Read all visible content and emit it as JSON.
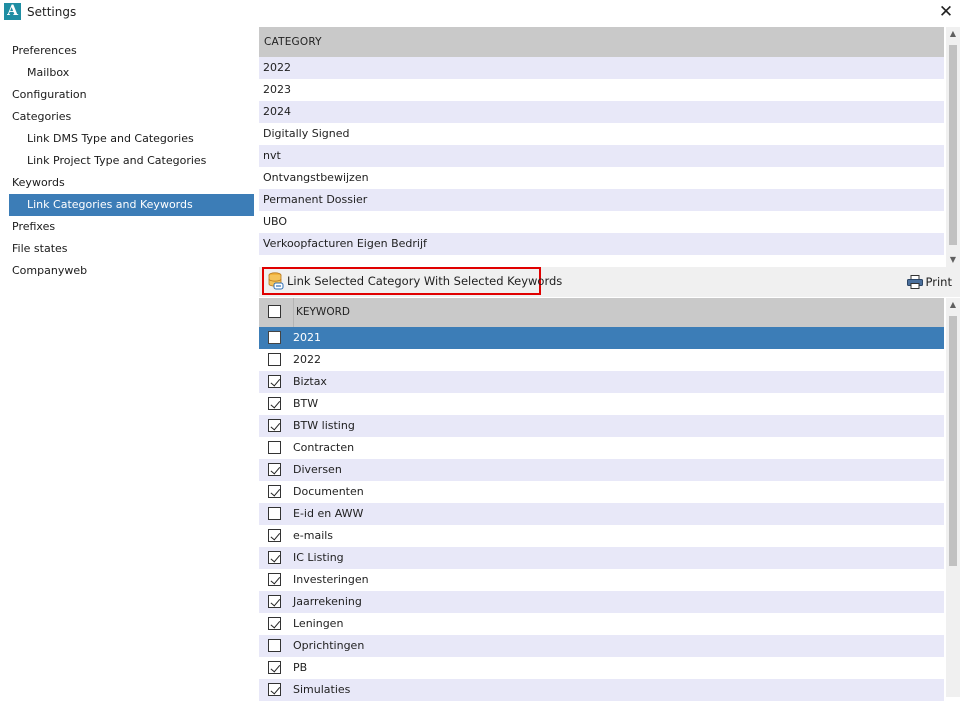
{
  "window": {
    "title": "Settings",
    "logo": "A"
  },
  "sidebar": {
    "items": [
      {
        "label": "Preferences",
        "level": 0,
        "selected": false
      },
      {
        "label": "Mailbox",
        "level": 1,
        "selected": false
      },
      {
        "label": "Configuration",
        "level": 0,
        "selected": false
      },
      {
        "label": "Categories",
        "level": 0,
        "selected": false
      },
      {
        "label": "Link DMS Type and Categories",
        "level": 1,
        "selected": false
      },
      {
        "label": "Link Project Type and Categories",
        "level": 1,
        "selected": false
      },
      {
        "label": "Keywords",
        "level": 0,
        "selected": false
      },
      {
        "label": "Link Categories and Keywords",
        "level": 1,
        "selected": true
      },
      {
        "label": "Prefixes",
        "level": 0,
        "selected": false
      },
      {
        "label": "File states",
        "level": 0,
        "selected": false
      },
      {
        "label": "Companyweb",
        "level": 0,
        "selected": false
      }
    ]
  },
  "category_grid": {
    "header": "CATEGORY",
    "rows": [
      "2022",
      "2023",
      "2024",
      "Digitally Signed",
      "nvt",
      "Ontvangstbewijzen",
      "Permanent Dossier",
      "UBO",
      "Verkoopfacturen Eigen Bedrijf"
    ]
  },
  "toolbar": {
    "link_label": "Link Selected Category With Selected Keywords",
    "print_label": "Print"
  },
  "keyword_grid": {
    "header": "KEYWORD",
    "header_checked": false,
    "rows": [
      {
        "label": "2021",
        "checked": false,
        "selected": true
      },
      {
        "label": "2022",
        "checked": false,
        "selected": false
      },
      {
        "label": "Biztax",
        "checked": true,
        "selected": false
      },
      {
        "label": "BTW",
        "checked": true,
        "selected": false
      },
      {
        "label": "BTW listing",
        "checked": true,
        "selected": false
      },
      {
        "label": "Contracten",
        "checked": false,
        "selected": false
      },
      {
        "label": "Diversen",
        "checked": true,
        "selected": false
      },
      {
        "label": "Documenten",
        "checked": true,
        "selected": false
      },
      {
        "label": "E-id en AWW",
        "checked": false,
        "selected": false
      },
      {
        "label": "e-mails",
        "checked": true,
        "selected": false
      },
      {
        "label": "IC Listing",
        "checked": true,
        "selected": false
      },
      {
        "label": "Investeringen",
        "checked": true,
        "selected": false
      },
      {
        "label": "Jaarrekening",
        "checked": true,
        "selected": false
      },
      {
        "label": "Leningen",
        "checked": true,
        "selected": false
      },
      {
        "label": "Oprichtingen",
        "checked": false,
        "selected": false
      },
      {
        "label": "PB",
        "checked": true,
        "selected": false
      },
      {
        "label": "Simulaties",
        "checked": true,
        "selected": false
      }
    ]
  },
  "colors": {
    "selection": "#3c7db7",
    "alt_row": "#e8e8f8",
    "header": "#c9c9c9",
    "highlight_border": "#e00000"
  },
  "icons": {
    "close": "close-icon",
    "link": "database-link-icon",
    "print": "printer-icon"
  }
}
